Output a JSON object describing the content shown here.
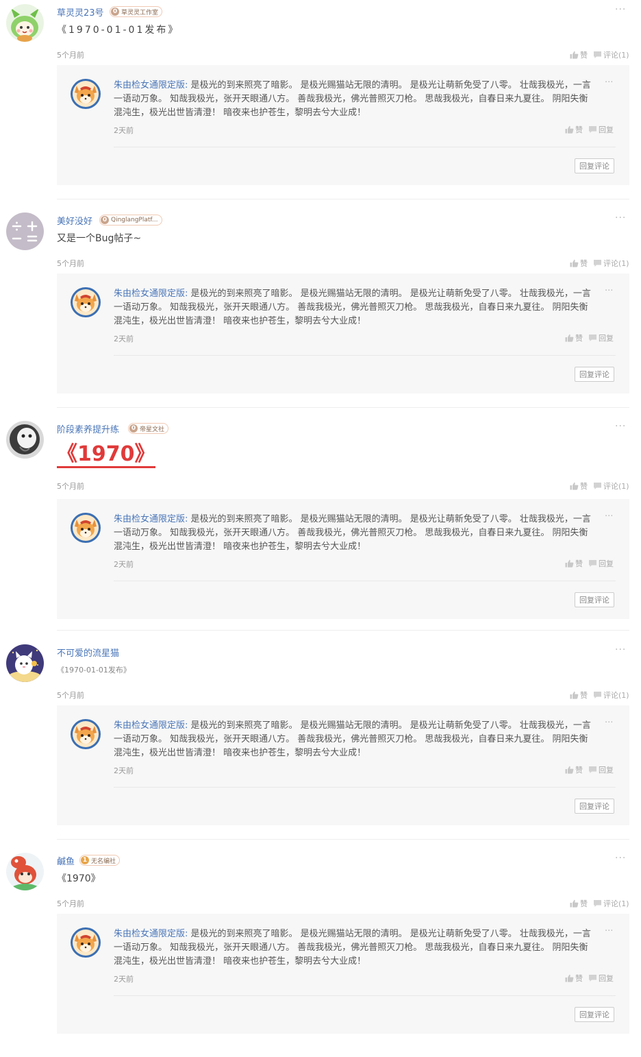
{
  "comments": [
    {
      "author": "草灵灵23号",
      "badge_level": "0",
      "badge_name": "草灵灵工作室",
      "content": "《1970-01-01发布》",
      "time": "5个月前",
      "like_label": "赞",
      "comment_label": "评论(1)",
      "more_label": "···",
      "reply": {
        "author": "朱由检女通限定版:",
        "text": "是极光的到来照亮了暗影。 是极光赐猫站无限的清明。 是极光让萌新免受了八零。 壮哉我极光，一言一语动万象。 知哉我极光，张开天眼通八方。 善哉我极光，佛光普照灭刀枪。 思哉我极光，自春日来九夏往。 阴阳失衡混沌生，极光出世皆清澄！ 暗夜来也护苍生，黎明去兮大业成！",
        "time": "2天前",
        "like_label": "赞",
        "reply_label": "回复",
        "reply_button": "回复评论",
        "more_label": "···"
      }
    },
    {
      "author": "美好没好",
      "badge_level": "0",
      "badge_name": "QinglangPlatf...",
      "content": "又是一个Bug帖子~",
      "time": "5个月前",
      "like_label": "赞",
      "comment_label": "评论(1)",
      "more_label": "···",
      "reply": {
        "author": "朱由检女通限定版:",
        "text": "是极光的到来照亮了暗影。 是极光赐猫站无限的清明。 是极光让萌新免受了八零。 壮哉我极光，一言一语动万象。 知哉我极光，张开天眼通八方。 善哉我极光，佛光普照灭刀枪。 思哉我极光，自春日来九夏往。 阴阳失衡混沌生，极光出世皆清澄！ 暗夜来也护苍生，黎明去兮大业成！",
        "time": "2天前",
        "like_label": "赞",
        "reply_label": "回复",
        "reply_button": "回复评论",
        "more_label": "···"
      }
    },
    {
      "author": "阶段素养提升练",
      "badge_level": "0",
      "badge_name": "帝星文社",
      "content": "《1970》",
      "time": "5个月前",
      "like_label": "赞",
      "comment_label": "评论(1)",
      "more_label": "···",
      "reply": {
        "author": "朱由检女通限定版:",
        "text": "是极光的到来照亮了暗影。 是极光赐猫站无限的清明。 是极光让萌新免受了八零。 壮哉我极光，一言一语动万象。 知哉我极光，张开天眼通八方。 善哉我极光，佛光普照灭刀枪。 思哉我极光，自春日来九夏往。 阴阳失衡混沌生，极光出世皆清澄！ 暗夜来也护苍生，黎明去兮大业成！",
        "time": "2天前",
        "like_label": "赞",
        "reply_label": "回复",
        "reply_button": "回复评论",
        "more_label": "···"
      }
    },
    {
      "author": "不可爱的流星猫",
      "content": "《1970-01-01发布》",
      "time": "5个月前",
      "like_label": "赞",
      "comment_label": "评论(1)",
      "more_label": "···",
      "reply": {
        "author": "朱由检女通限定版:",
        "text": "是极光的到来照亮了暗影。 是极光赐猫站无限的清明。 是极光让萌新免受了八零。 壮哉我极光，一言一语动万象。 知哉我极光，张开天眼通八方。 善哉我极光，佛光普照灭刀枪。 思哉我极光，自春日来九夏往。 阴阳失衡混沌生，极光出世皆清澄！ 暗夜来也护苍生，黎明去兮大业成！",
        "time": "2天前",
        "like_label": "赞",
        "reply_label": "回复",
        "reply_button": "回复评论",
        "more_label": "···"
      }
    },
    {
      "author": "鹹鱼",
      "badge_level": "1",
      "badge_name": "无名编社",
      "content": "《1970》",
      "time": "5个月前",
      "like_label": "赞",
      "comment_label": "评论(1)",
      "more_label": "···",
      "reply": {
        "author": "朱由检女通限定版:",
        "text": "是极光的到来照亮了暗影。 是极光赐猫站无限的清明。 是极光让萌新免受了八零。 壮哉我极光，一言一语动万象。 知哉我极光，张开天眼通八方。 善哉我极光，佛光普照灭刀枪。 思哉我极光，自春日来九夏往。 阴阳失衡混沌生，极光出世皆清澄！ 暗夜来也护苍生，黎明去兮大业成！",
        "time": "2天前",
        "like_label": "赞",
        "reply_label": "回复",
        "reply_button": "回复评论",
        "more_label": "···"
      }
    }
  ]
}
